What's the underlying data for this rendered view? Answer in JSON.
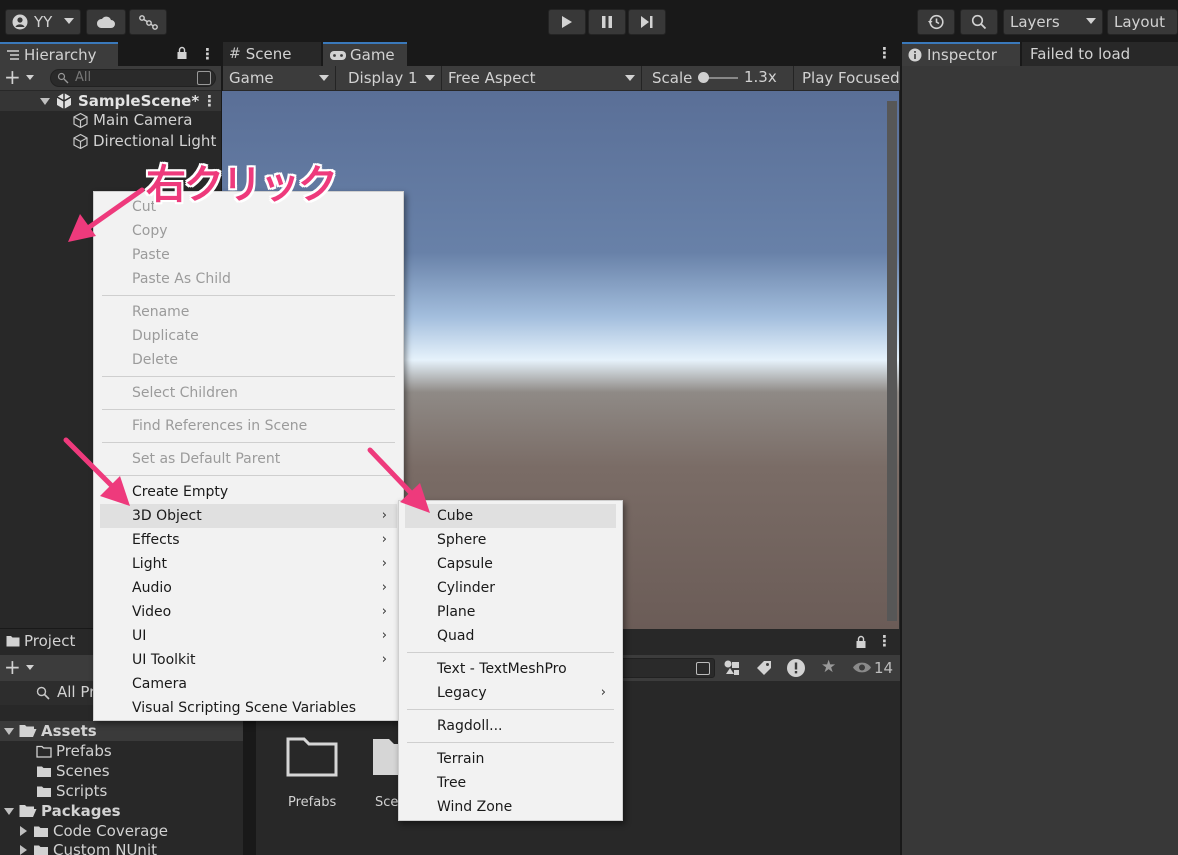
{
  "toolbar": {
    "account_label": "YY",
    "layers_label": "Layers",
    "layout_label": "Layout"
  },
  "hierarchy": {
    "tab_label": "Hierarchy",
    "search_placeholder": "All",
    "scene_name": "SampleScene*",
    "items": [
      "Main Camera",
      "Directional Light"
    ]
  },
  "game": {
    "scene_tab": "Scene",
    "game_tab": "Game",
    "mode_dropdown": "Game",
    "display_dropdown": "Display 1",
    "aspect_dropdown": "Free Aspect",
    "scale_label": "Scale",
    "scale_value": "1.3x",
    "play_focused": "Play Focused"
  },
  "inspector": {
    "tab_label": "Inspector",
    "failed_tab": "Failed to load"
  },
  "project": {
    "tab_label": "Project",
    "search_text": "All Pr",
    "hidden_count": "14",
    "tree": {
      "assets": "Assets",
      "assets_children": [
        "Prefabs",
        "Scenes",
        "Scripts"
      ],
      "packages": "Packages",
      "packages_children": [
        "Code Coverage",
        "Custom NUnit"
      ]
    },
    "grid_items": [
      "Prefabs",
      "Sce"
    ]
  },
  "context_menu": {
    "edit_group": [
      "Cut",
      "Copy",
      "Paste",
      "Paste As Child"
    ],
    "object_group": [
      "Rename",
      "Duplicate",
      "Delete"
    ],
    "select_children": "Select Children",
    "find_references": "Find References in Scene",
    "set_default_parent": "Set as Default Parent",
    "create_group": [
      "Create Empty",
      "3D Object",
      "Effects",
      "Light",
      "Audio",
      "Video",
      "UI",
      "UI Toolkit",
      "Camera",
      "Visual Scripting Scene Variables"
    ]
  },
  "submenu_3d": {
    "primitives": [
      "Cube",
      "Sphere",
      "Capsule",
      "Cylinder",
      "Plane",
      "Quad"
    ],
    "text_group": [
      "Text - TextMeshPro",
      "Legacy"
    ],
    "ragdoll": "Ragdoll...",
    "env_group": [
      "Terrain",
      "Tree",
      "Wind Zone"
    ]
  },
  "annotation": {
    "label": "右クリック",
    "color": "#ee3a7c"
  }
}
